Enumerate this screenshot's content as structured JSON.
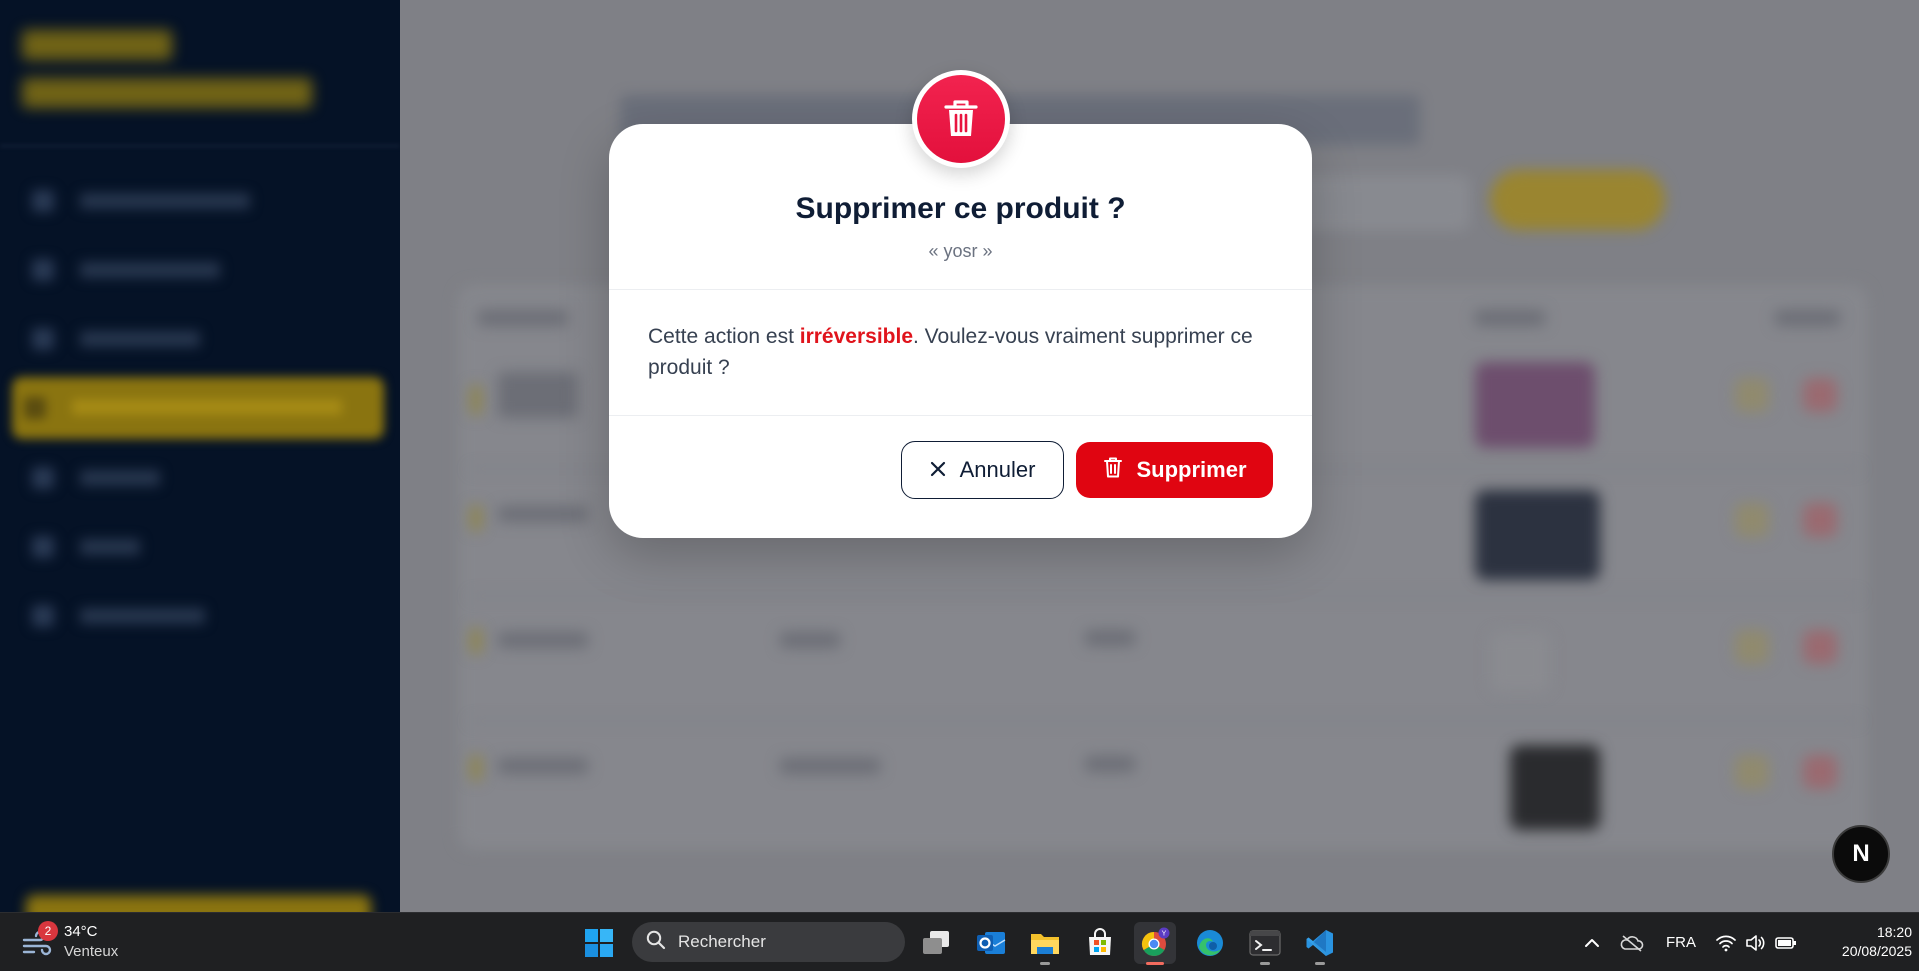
{
  "modal": {
    "title": "Supprimer ce produit ?",
    "subtitle": "« yosr »",
    "body_prefix": "Cette action est ",
    "body_emphasis": "irréversible",
    "body_suffix": ". Voulez-vous vraiment supprimer ce produit ?",
    "cancel_label": "Annuler",
    "delete_label": "Supprimer",
    "icon": "trash-icon",
    "accent_color": "#e00511"
  },
  "floating_badge": {
    "label": "N"
  },
  "taskbar": {
    "weather": {
      "badge_count": "2",
      "temperature": "34°C",
      "condition": "Venteux",
      "icon": "wind-icon"
    },
    "search": {
      "placeholder": "Rechercher"
    },
    "apps": [
      {
        "name": "start-icon"
      },
      {
        "name": "task-view-icon"
      },
      {
        "name": "outlook-icon"
      },
      {
        "name": "file-explorer-icon"
      },
      {
        "name": "microsoft-store-icon"
      },
      {
        "name": "chrome-icon"
      },
      {
        "name": "edge-icon"
      },
      {
        "name": "terminal-icon"
      },
      {
        "name": "vscode-icon"
      }
    ],
    "tray": {
      "language": "FRA",
      "icons": [
        "chevron-up-icon",
        "onedrive-icon",
        "wifi-icon",
        "volume-icon",
        "battery-icon"
      ]
    },
    "clock": {
      "time": "18:20",
      "date": "20/08/2025"
    }
  }
}
